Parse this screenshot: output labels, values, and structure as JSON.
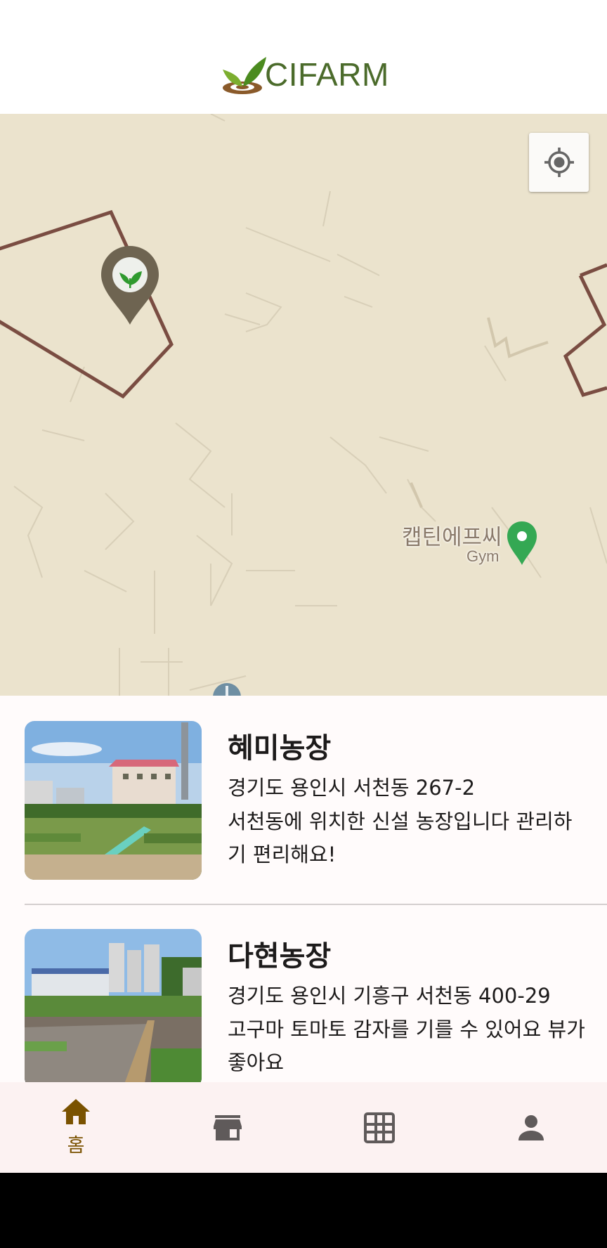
{
  "app": {
    "logo_text": "CIFARM"
  },
  "map": {
    "poi": {
      "name": "캡틴에프씨",
      "type": "Gym"
    },
    "locate_icon": "my-location-icon",
    "farm_marker_icon": "sprout-pin-icon"
  },
  "farms": [
    {
      "name": "혜미농장",
      "address": "경기도 용인시 서천동 267-2",
      "description": "서천동에 위치한 신설 농장입니다 관리하기 편리해요!"
    },
    {
      "name": "다현농장",
      "address": "경기도 용인시 기흥구 서천동 400-29",
      "description": "고구마 토마토 감자를 기를 수 있어요 뷰가 좋아요"
    }
  ],
  "nav": {
    "items": [
      {
        "label": "홈",
        "icon": "home-icon",
        "active": true
      },
      {
        "label": "",
        "icon": "store-icon",
        "active": false
      },
      {
        "label": "",
        "icon": "grid-icon",
        "active": false
      },
      {
        "label": "",
        "icon": "person-icon",
        "active": false
      }
    ]
  },
  "colors": {
    "brand_green": "#4b6b2b",
    "map_background": "#ebe3cd",
    "farm_boundary": "#7a4d42",
    "active_nav": "#7a5200",
    "inactive_nav": "#5f5a5a",
    "poi_green": "#34a853"
  }
}
